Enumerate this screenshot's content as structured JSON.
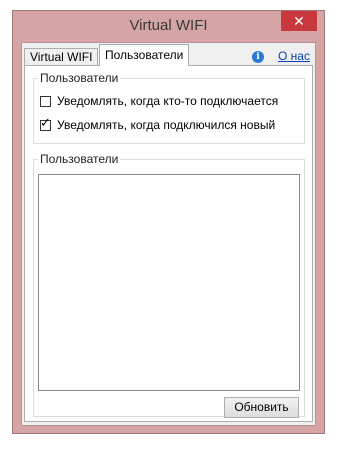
{
  "window": {
    "title": "Virtual WIFI",
    "close_glyph": "✕"
  },
  "tabs": [
    {
      "label": "Virtual WIFI",
      "active": false
    },
    {
      "label": "Пользователи",
      "active": true
    }
  ],
  "about": {
    "icon": "info-icon",
    "label": "О нас"
  },
  "notify_group": {
    "title": "Пользователи",
    "options": [
      {
        "label": "Уведомлять, когда кто-то подключается",
        "checked": false
      },
      {
        "label": "Уведомлять, когда подключился новый",
        "checked": true
      }
    ]
  },
  "users_group": {
    "title": "Пользователи",
    "items": [],
    "refresh_label": "Обновить"
  },
  "colors": {
    "frame": "#d5a5a5",
    "close": "#c7373b",
    "link": "#0b3fb8"
  }
}
